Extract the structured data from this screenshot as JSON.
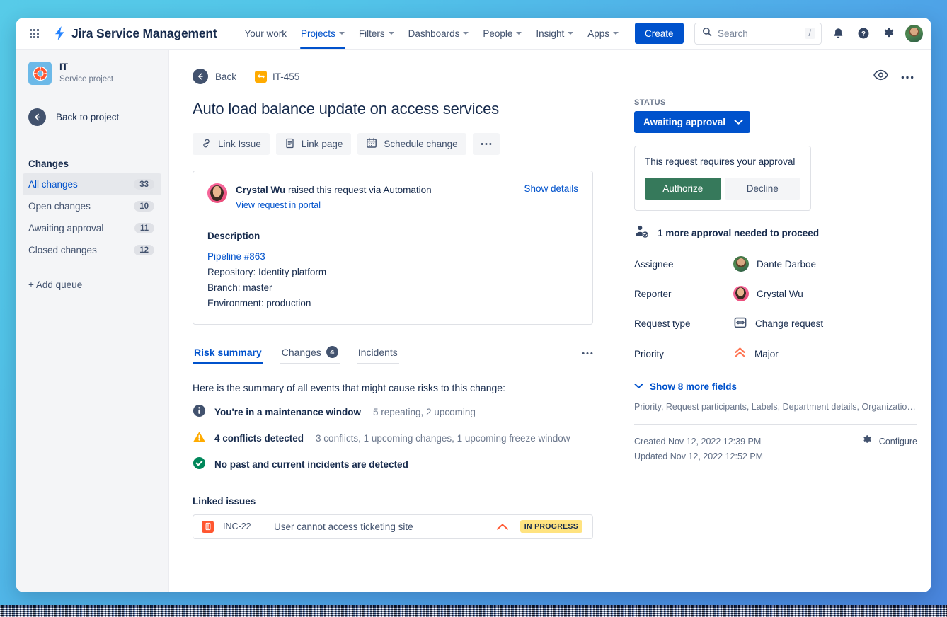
{
  "topnav": {
    "app_grid_icon": "app-switcher-icon",
    "logo_icon": "jira-bolt-icon",
    "product_name": "Jira Service Management",
    "items": [
      {
        "label": "Your work",
        "has_caret": false,
        "active": false
      },
      {
        "label": "Projects",
        "has_caret": true,
        "active": true
      },
      {
        "label": "Filters",
        "has_caret": true,
        "active": false
      },
      {
        "label": "Dashboards",
        "has_caret": true,
        "active": false
      },
      {
        "label": "People",
        "has_caret": true,
        "active": false
      },
      {
        "label": "Insight",
        "has_caret": true,
        "active": false
      },
      {
        "label": "Apps",
        "has_caret": true,
        "active": false
      }
    ],
    "create_label": "Create",
    "search": {
      "placeholder": "Search",
      "value": "",
      "shortcut": "/",
      "icon": "search-icon"
    },
    "notifications_icon": "bell-icon",
    "help_icon": "help-circle-icon",
    "settings_icon": "gear-icon",
    "profile_icon": "user-avatar"
  },
  "sidebar": {
    "project": {
      "name": "IT",
      "subtitle": "Service project",
      "icon": "lifering-icon"
    },
    "back_to_project": {
      "label": "Back to project",
      "icon": "arrow-left-icon"
    },
    "section_title": "Changes",
    "queues": [
      {
        "label": "All changes",
        "count": "33",
        "selected": true
      },
      {
        "label": "Open changes",
        "count": "10",
        "selected": false
      },
      {
        "label": "Awaiting approval",
        "count": "11",
        "selected": false
      },
      {
        "label": "Closed changes",
        "count": "12",
        "selected": false
      }
    ],
    "add_queue": "+ Add queue"
  },
  "issue": {
    "back_label": "Back",
    "key": "IT-455",
    "key_icon": "change-request-icon",
    "title": "Auto load balance update on access services",
    "actions": [
      {
        "label": "Link Issue",
        "icon": "link-icon"
      },
      {
        "label": "Link page",
        "icon": "page-icon"
      },
      {
        "label": "Schedule change",
        "icon": "calendar-icon"
      }
    ],
    "more_actions_icon": "more-horizontal-icon",
    "watch_icon": "eye-icon",
    "page_more_icon": "more-horizontal-icon"
  },
  "request_card": {
    "reporter_name": "Crystal Wu",
    "raised_text": " raised this request via Automation",
    "portal_link": "View request in portal",
    "show_details": "Show details",
    "description_heading": "Description",
    "description_link": "Pipeline #863",
    "description_lines": [
      "Repository: Identity platform",
      "Branch: master",
      "Environment: production"
    ]
  },
  "tabs": [
    {
      "label": "Risk summary",
      "badge": "",
      "active": true
    },
    {
      "label": "Changes",
      "badge": "4",
      "active": false
    },
    {
      "label": "Incidents",
      "badge": "",
      "active": false
    }
  ],
  "risk": {
    "intro": "Here is the summary of all events that might cause risks to this change:",
    "items": [
      {
        "icon": "info-icon",
        "text": "You're in a maintenance window",
        "sub": "5 repeating, 2 upcoming"
      },
      {
        "icon": "warning-icon",
        "text": "4 conflicts detected",
        "sub": "3 conflicts, 1 upcoming changes, 1 upcoming freeze window"
      },
      {
        "icon": "success-check-icon",
        "text": "No past and current incidents are detected",
        "sub": ""
      }
    ]
  },
  "linked_issues": {
    "heading": "Linked issues",
    "rows": [
      {
        "key": "INC-22",
        "icon": "incident-icon",
        "summary": "User cannot access ticketing site",
        "priority_icon": "priority-high-icon",
        "status": "IN PROGRESS"
      }
    ]
  },
  "details": {
    "status_label": "STATUS",
    "status_value": "Awaiting approval",
    "status_caret_icon": "chevron-down-icon",
    "approval": {
      "message": "This request requires your approval",
      "authorize_label": "Authorize",
      "decline_label": "Decline",
      "note": "1 more approval needed to proceed",
      "note_icon": "person-check-icon"
    },
    "fields": [
      {
        "label": "Assignee",
        "value": "Dante Darboe",
        "icon": "dante-avatar"
      },
      {
        "label": "Reporter",
        "value": "Crystal Wu",
        "icon": "crystal-avatar"
      },
      {
        "label": "Request type",
        "value": "Change request",
        "icon": "change-request-icon"
      },
      {
        "label": "Priority",
        "value": "Major",
        "icon": "priority-major-icon"
      }
    ],
    "show_more_label": "Show 8 more fields",
    "show_more_icon": "chevron-down-icon",
    "hidden_fields_preview": "Priority, Request participants, Labels, Department details, Organizations, T...",
    "created": "Created Nov 12, 2022 12:39 PM",
    "updated": "Updated Nov 12, 2022 12:52 PM",
    "configure_label": "Configure",
    "configure_icon": "gear-icon"
  },
  "colors": {
    "brand_blue": "#0052cc",
    "status_blue": "#0052cc",
    "authorize_green": "#36795b",
    "warning_amber": "#ffab00",
    "incident_red": "#ff5630",
    "progress_yellow": "#ffe380",
    "text_primary": "#172b4d",
    "text_subtle": "#6b778c"
  }
}
